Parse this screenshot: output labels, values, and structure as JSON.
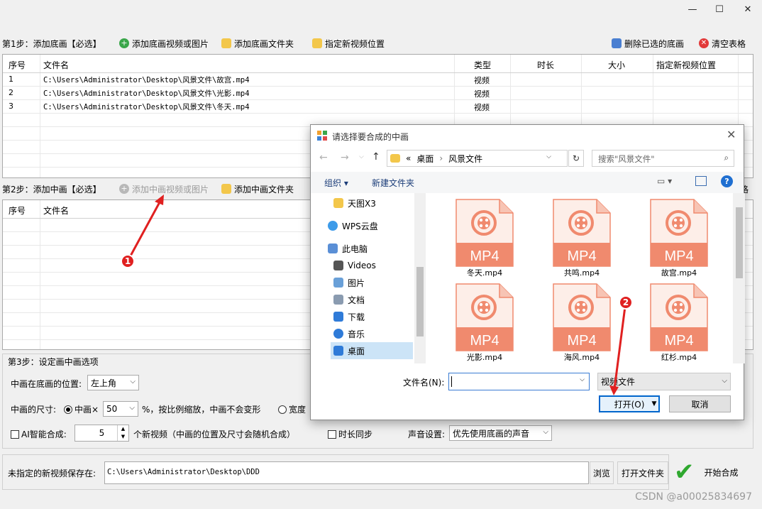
{
  "window": {
    "minimize": "—",
    "maximize": "☐",
    "close": "✕"
  },
  "step1": {
    "label": "第1步：添加底画【必选】",
    "add_media": "添加底画视频或图片",
    "add_folder": "添加底画文件夹",
    "set_position": "指定新视频位置",
    "delete_selected": "删除已选的底画",
    "clear_table": "清空表格",
    "columns": [
      "序号",
      "文件名",
      "类型",
      "时长",
      "大小",
      "指定新视频位置"
    ],
    "rows": [
      {
        "no": "1",
        "name": "C:\\Users\\Administrator\\Desktop\\风景文件\\故宫.mp4",
        "type": "视频"
      },
      {
        "no": "2",
        "name": "C:\\Users\\Administrator\\Desktop\\风景文件\\光影.mp4",
        "type": "视频"
      },
      {
        "no": "3",
        "name": "C:\\Users\\Administrator\\Desktop\\风景文件\\冬天.mp4",
        "type": "视频"
      }
    ]
  },
  "step2": {
    "label": "第2步：添加中画【必选】",
    "add_media": "添加中画视频或图片",
    "add_folder": "添加中画文件夹",
    "right_edge": "格",
    "columns": [
      "序号",
      "文件名"
    ]
  },
  "step3": {
    "label": "第3步：设定画中画选项",
    "position_label": "中画在底画的位置:",
    "position_value": "左上角",
    "size_label": "中画的尺寸:",
    "size_radio": "中画×",
    "size_value": "50",
    "size_suffix": "%，按比例缩放，中画不会变形",
    "width_radio": "宽度",
    "ai_label": "AI智能合成:",
    "ai_count": "5",
    "ai_suffix": "个新视频（中画的位置及尺寸会随机合成）",
    "duration_sync": "时长同步",
    "audio_label": "声音设置:",
    "audio_value": "优先使用底画的声音"
  },
  "output": {
    "label": "未指定的新视频保存在:",
    "path": "C:\\Users\\Administrator\\Desktop\\DDD",
    "browse": "浏览",
    "open_folder": "打开文件夹",
    "start": "开始合成"
  },
  "dialog": {
    "title": "请选择要合成的中画",
    "breadcrumb": [
      "«",
      "桌面",
      "风景文件"
    ],
    "search_placeholder": "搜索\"风景文件\"",
    "organize": "组织 ▾",
    "new_folder": "新建文件夹",
    "nav": [
      {
        "label": "天图X3",
        "icon": "folder-icon"
      },
      {
        "label": "WPS云盘",
        "icon": "cloud-icon"
      },
      {
        "label": "此电脑",
        "icon": "computer-icon"
      },
      {
        "label": "Videos",
        "icon": "video-folder-icon"
      },
      {
        "label": "图片",
        "icon": "pictures-icon"
      },
      {
        "label": "文档",
        "icon": "documents-icon"
      },
      {
        "label": "下载",
        "icon": "download-icon"
      },
      {
        "label": "音乐",
        "icon": "music-icon"
      },
      {
        "label": "桌面",
        "icon": "desktop-icon"
      }
    ],
    "files": [
      {
        "name": "冬天.mp4",
        "ext": "MP4"
      },
      {
        "name": "共鸣.mp4",
        "ext": "MP4"
      },
      {
        "name": "故宫.mp4",
        "ext": "MP4"
      },
      {
        "name": "光影.mp4",
        "ext": "MP4"
      },
      {
        "name": "海风.mp4",
        "ext": "MP4"
      },
      {
        "name": "红杉.mp4",
        "ext": "MP4"
      }
    ],
    "filename_label": "文件名(N):",
    "filename_value": "",
    "filetype": "视频文件",
    "open": "打开(O)",
    "cancel": "取消"
  },
  "annotations": {
    "badge1": "1",
    "badge2": "2"
  },
  "watermark": "CSDN @a00025834697",
  "colors": {
    "mp4": "#f08a6e",
    "red_arrow": "#e02020",
    "accent_blue": "#0066cc"
  }
}
